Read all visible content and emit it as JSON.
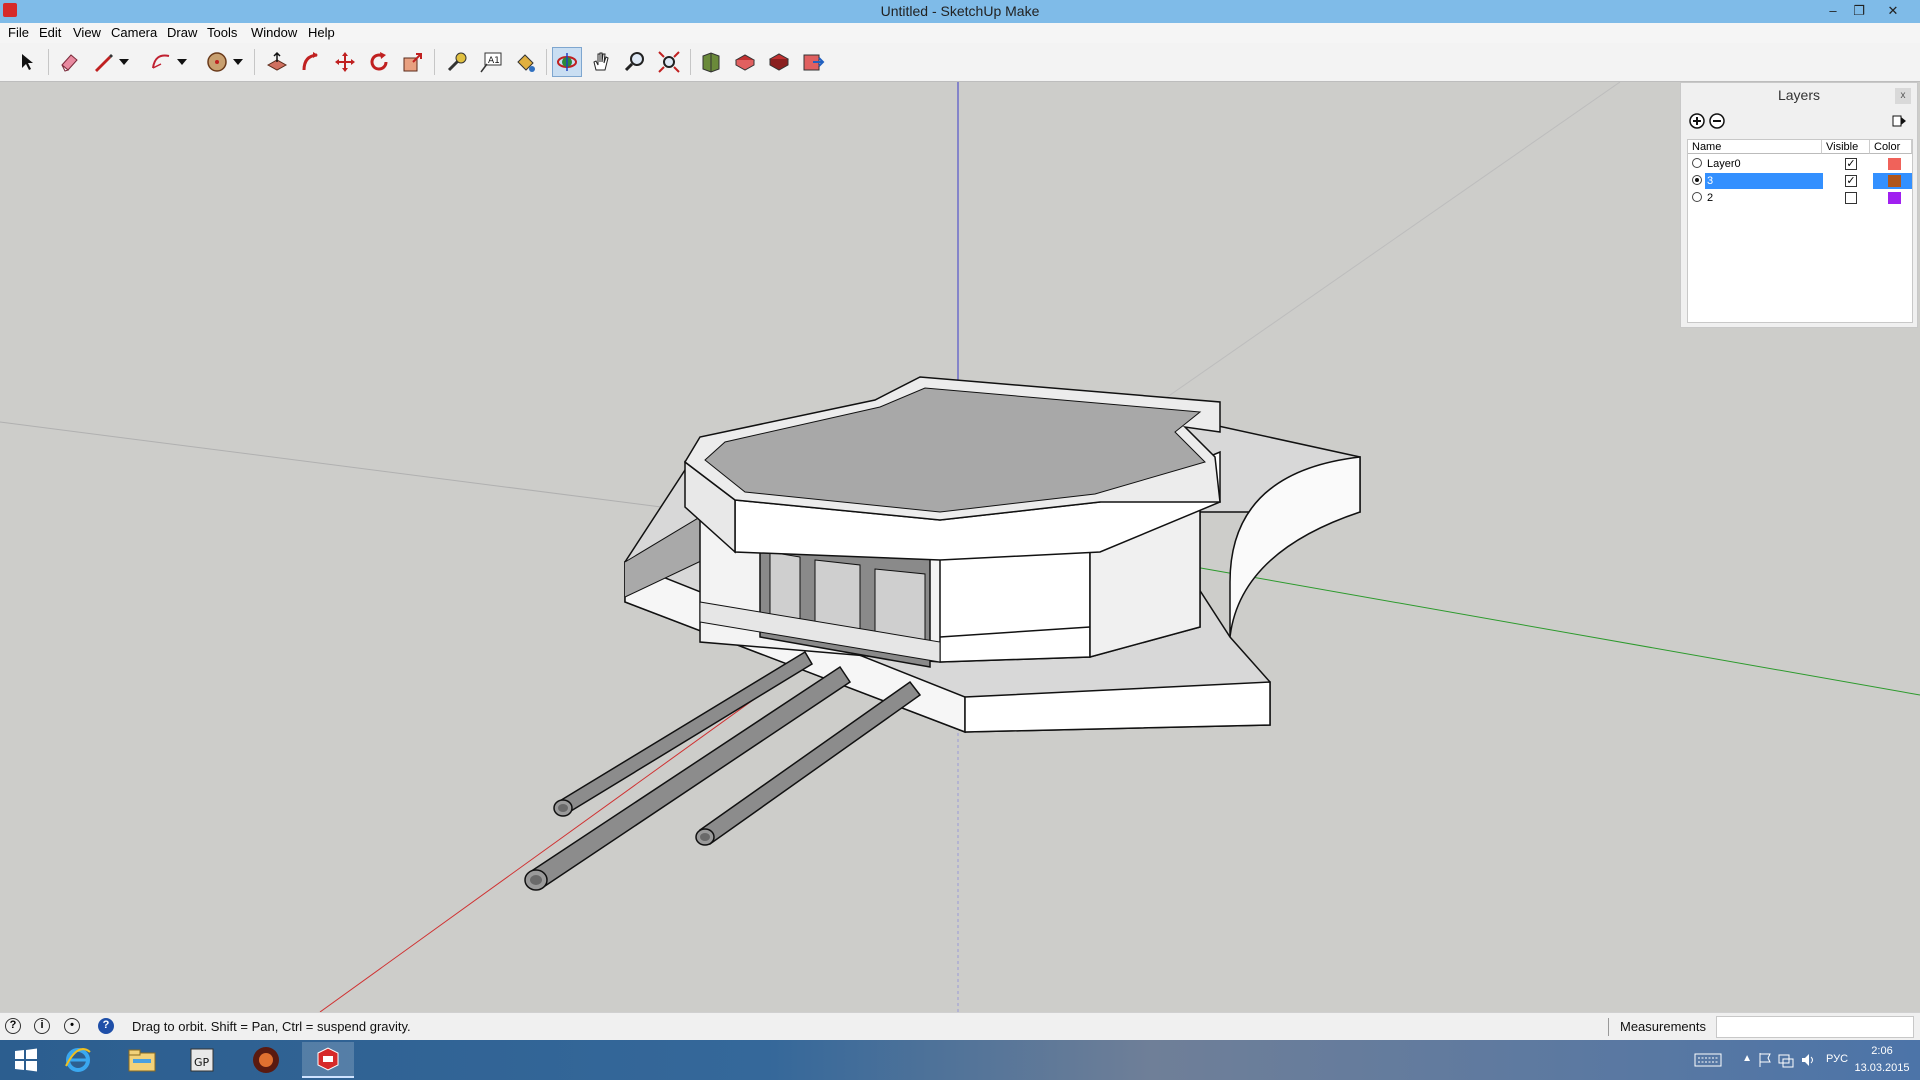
{
  "window": {
    "title": "Untitled - SketchUp Make"
  },
  "menu": [
    "File",
    "Edit",
    "View",
    "Camera",
    "Draw",
    "Tools",
    "Window",
    "Help"
  ],
  "toolbar": {
    "tools": [
      "select",
      "eraser",
      "line",
      "line-dropdown",
      "arc",
      "arc-dropdown",
      "shape",
      "shape-dropdown",
      "push-pull",
      "follow-me",
      "move",
      "rotate",
      "scale",
      "tape-measure",
      "text",
      "paint-bucket",
      "orbit",
      "pan",
      "zoom",
      "zoom-extents",
      "3d-warehouse",
      "share-model",
      "extension-warehouse",
      "send-to-layout"
    ],
    "active_tool": "orbit"
  },
  "layers_panel": {
    "title": "Layers",
    "close_label": "x",
    "columns": {
      "name": "Name",
      "visible": "Visible",
      "color": "Color"
    },
    "rows": [
      {
        "name": "Layer0",
        "active": false,
        "selected": false,
        "visible": true,
        "color": "#f0625a"
      },
      {
        "name": "3",
        "active": true,
        "selected": true,
        "visible": true,
        "color": "#b0561c"
      },
      {
        "name": "2",
        "active": false,
        "selected": false,
        "visible": false,
        "color": "#a020f0"
      }
    ]
  },
  "statusbar": {
    "message": "Drag to orbit. Shift = Pan, Ctrl = suspend gravity.",
    "measurements_label": "Measurements",
    "measurements_value": ""
  },
  "taskbar": {
    "apps": [
      "Start",
      "Internet Explorer",
      "File Explorer",
      "GP",
      "Media",
      "SketchUp"
    ],
    "language": "РУС",
    "time": "2:06",
    "date": "13.03.2015"
  }
}
